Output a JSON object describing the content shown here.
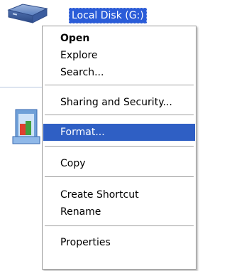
{
  "drive": {
    "label": "Local Disk (G:)",
    "icon": "hard-drive-icon"
  },
  "menu": {
    "items": [
      {
        "label": "Open",
        "bold": true
      },
      {
        "label": "Explore"
      },
      {
        "label": "Search..."
      },
      {
        "label": "Sharing and Security..."
      },
      {
        "label": "Format...",
        "selected": true
      },
      {
        "label": "Copy"
      },
      {
        "label": "Create Shortcut"
      },
      {
        "label": "Rename"
      },
      {
        "label": "Properties"
      }
    ]
  },
  "colors": {
    "selection": "#2f5fc4",
    "drive_label_highlight": "#2a5cd8"
  }
}
